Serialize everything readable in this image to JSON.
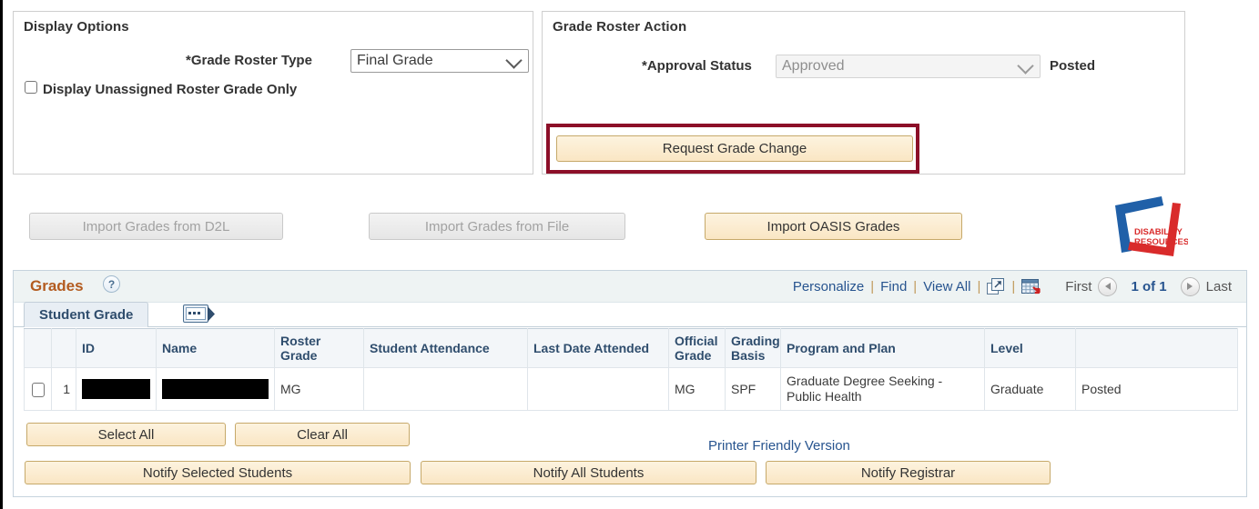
{
  "display_options": {
    "title": "Display Options",
    "grade_roster_type_label": "*Grade Roster Type",
    "grade_roster_type_value": "Final Grade",
    "grade_roster_type_options": [
      "Final Grade"
    ],
    "unassigned_checkbox_label": "Display Unassigned Roster Grade Only",
    "unassigned_checked": false
  },
  "grade_roster_action": {
    "title": "Grade Roster Action",
    "approval_status_label": "*Approval Status",
    "approval_status_value": "Approved",
    "approval_status_options": [
      "Approved"
    ],
    "posted_label": "Posted",
    "request_grade_change_label": "Request Grade Change",
    "highlight_color": "#8c0f28"
  },
  "import_buttons": [
    {
      "label": "Import Grades from D2L",
      "disabled": true
    },
    {
      "label": "Import Grades from File",
      "disabled": true
    },
    {
      "label": "Import OASIS Grades",
      "disabled": false
    }
  ],
  "logo": {
    "name": "disability-resources-logo",
    "line1": "DISABILITY",
    "line2": "RESOURCES",
    "blue": "#1f5fa9",
    "red": "#d92b2b"
  },
  "grades_panel": {
    "title": "Grades",
    "help_icon": "?",
    "tab_label": "Student Grade",
    "tab_expand_icon": "show-next-tab-icon",
    "links": [
      {
        "label": "Personalize",
        "name": "personalize-link"
      },
      {
        "label": "Find",
        "name": "find-link"
      },
      {
        "label": "View All",
        "name": "view-all-link"
      }
    ],
    "icons": [
      {
        "name": "zoom-expand-icon"
      },
      {
        "name": "download-spreadsheet-icon"
      }
    ],
    "nav": {
      "first_label": "First",
      "count_label": "1 of 1",
      "last_label": "Last"
    },
    "columns": [
      "",
      "",
      "ID",
      "Name",
      "Roster Grade",
      "Student Attendance",
      "Last Date Attended",
      "Official Grade",
      "Grading Basis",
      "Program and Plan",
      "Level",
      ""
    ],
    "rows": [
      {
        "selected": false,
        "index": "1",
        "id": "",
        "id_redacted": true,
        "name": "",
        "name_redacted": true,
        "roster_grade": "MG",
        "student_attendance": "",
        "last_date_attended": "",
        "official_grade": "MG",
        "grading_basis": "SPF",
        "program_and_plan": "Graduate Degree Seeking - Public Health",
        "level": "Graduate",
        "status": "Posted"
      }
    ]
  },
  "bottom_actions": {
    "select_all_label": "Select All",
    "clear_all_label": "Clear All",
    "printer_friendly_label": "Printer Friendly Version",
    "notify_selected_label": "Notify Selected Students",
    "notify_all_label": "Notify All Students",
    "notify_registrar_label": "Notify Registrar"
  }
}
